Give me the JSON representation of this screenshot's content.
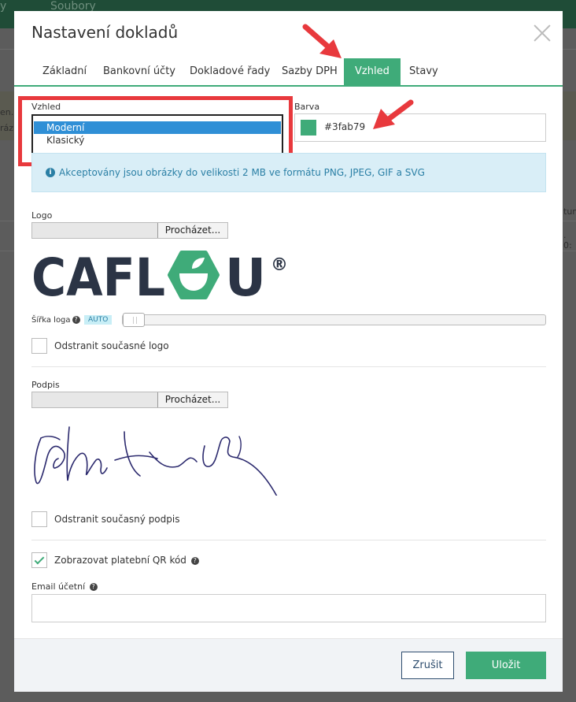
{
  "background": {
    "nav_partial": "y",
    "nav_files": "Soubory",
    "fragments": [
      "en. (",
      "ráz",
      "tum",
      ". 0:"
    ]
  },
  "modal": {
    "title": "Nastavení dokladů",
    "tabs": [
      {
        "label": "Základní"
      },
      {
        "label": "Bankovní účty"
      },
      {
        "label": "Dokladové řady"
      },
      {
        "label": "Sazby DPH"
      },
      {
        "label": "Vzhled"
      },
      {
        "label": "Stavy"
      }
    ],
    "active_tab": "Vzhled"
  },
  "appearance": {
    "label": "Vzhled",
    "options": [
      "Moderní",
      "Klasický"
    ],
    "selected": "Moderní"
  },
  "color": {
    "label": "Barva",
    "value": "#3fab79"
  },
  "info": {
    "text": "Akceptovány jsou obrázky do velikosti 2 MB ve formátu PNG, JPEG, GIF a SVG"
  },
  "logo": {
    "label": "Logo",
    "browse": "Procházet...",
    "brand": "CAFLOU",
    "brand_left": "CAFL",
    "brand_right": "U",
    "registered": "®",
    "width_label": "Šířka loga",
    "width_badge": "AUTO",
    "remove_label": "Odstranit současné logo"
  },
  "signature": {
    "label": "Podpis",
    "browse": "Procházet...",
    "remove_label": "Odstranit současný podpis"
  },
  "qr": {
    "label": "Zobrazovat platební QR kód",
    "checked": true
  },
  "email": {
    "label": "Email účetní",
    "value": ""
  },
  "footer": {
    "cancel": "Zrušit",
    "save": "Uložit"
  },
  "colors": {
    "accent": "#3fab79",
    "highlight": "#e8393d",
    "info_text": "#2a7fa5",
    "select_highlight": "#2f8fd6"
  }
}
